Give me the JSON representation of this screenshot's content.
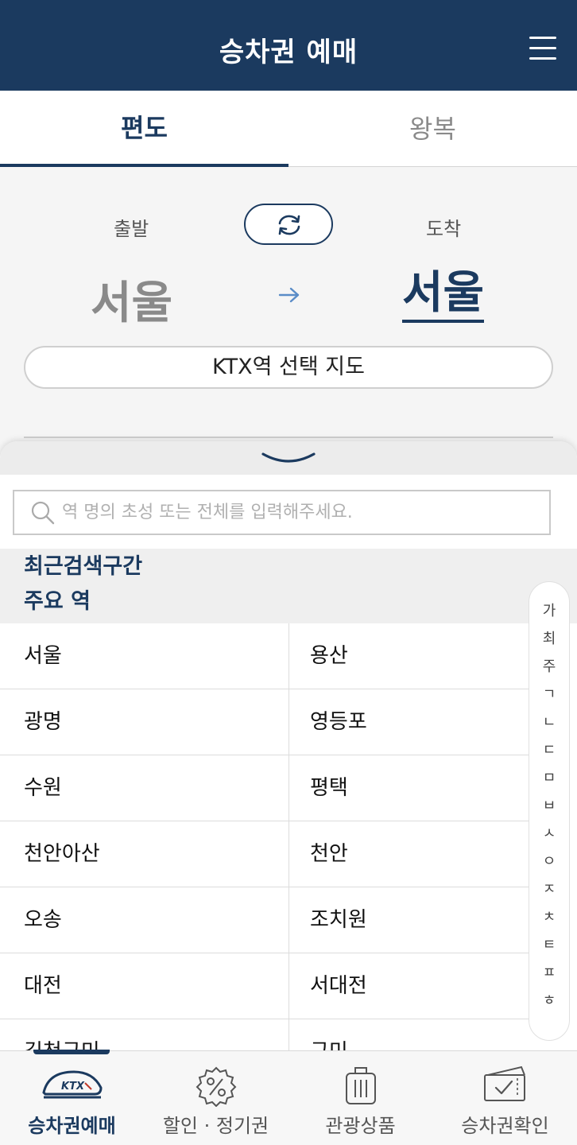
{
  "header": {
    "title": "승차권 예매",
    "menu_icon": "hamburger-menu-icon"
  },
  "tabs": [
    {
      "label": "편도",
      "active": true
    },
    {
      "label": "왕복",
      "active": false
    }
  ],
  "route": {
    "departure_label": "출발",
    "arrival_label": "도착",
    "departure_station": "서울",
    "arrival_station": "서울",
    "swap_icon": "swap-icon",
    "arrow_icon": "arrow-right-icon",
    "map_button": "KTX역 선택 지도"
  },
  "sheet": {
    "search_placeholder": "역 명의 초성 또는 전체를 입력해주세요.",
    "recent_heading": "최근검색구간",
    "major_heading": "주요 역",
    "stations": [
      [
        "서울",
        "용산"
      ],
      [
        "광명",
        "영등포"
      ],
      [
        "수원",
        "평택"
      ],
      [
        "천안아산",
        "천안"
      ],
      [
        "오송",
        "조치원"
      ],
      [
        "대전",
        "서대전"
      ],
      [
        "김천구미",
        "구미"
      ]
    ],
    "index": [
      "가",
      "최",
      "주",
      "ㄱ",
      "ㄴ",
      "ㄷ",
      "ㅁ",
      "ㅂ",
      "ㅅ",
      "ㅇ",
      "ㅈ",
      "ㅊ",
      "ㅌ",
      "ㅍ",
      "ㅎ"
    ]
  },
  "nav": [
    {
      "label": "승차권예매",
      "icon": "ktx-train-icon",
      "active": true
    },
    {
      "label": "할인 · 정기권",
      "icon": "discount-badge-icon",
      "active": false
    },
    {
      "label": "관광상품",
      "icon": "luggage-icon",
      "active": false
    },
    {
      "label": "승차권확인",
      "icon": "ticket-check-icon",
      "active": false
    }
  ],
  "colors": {
    "primary": "#1b3a5f",
    "background": "#f5f5f5"
  }
}
